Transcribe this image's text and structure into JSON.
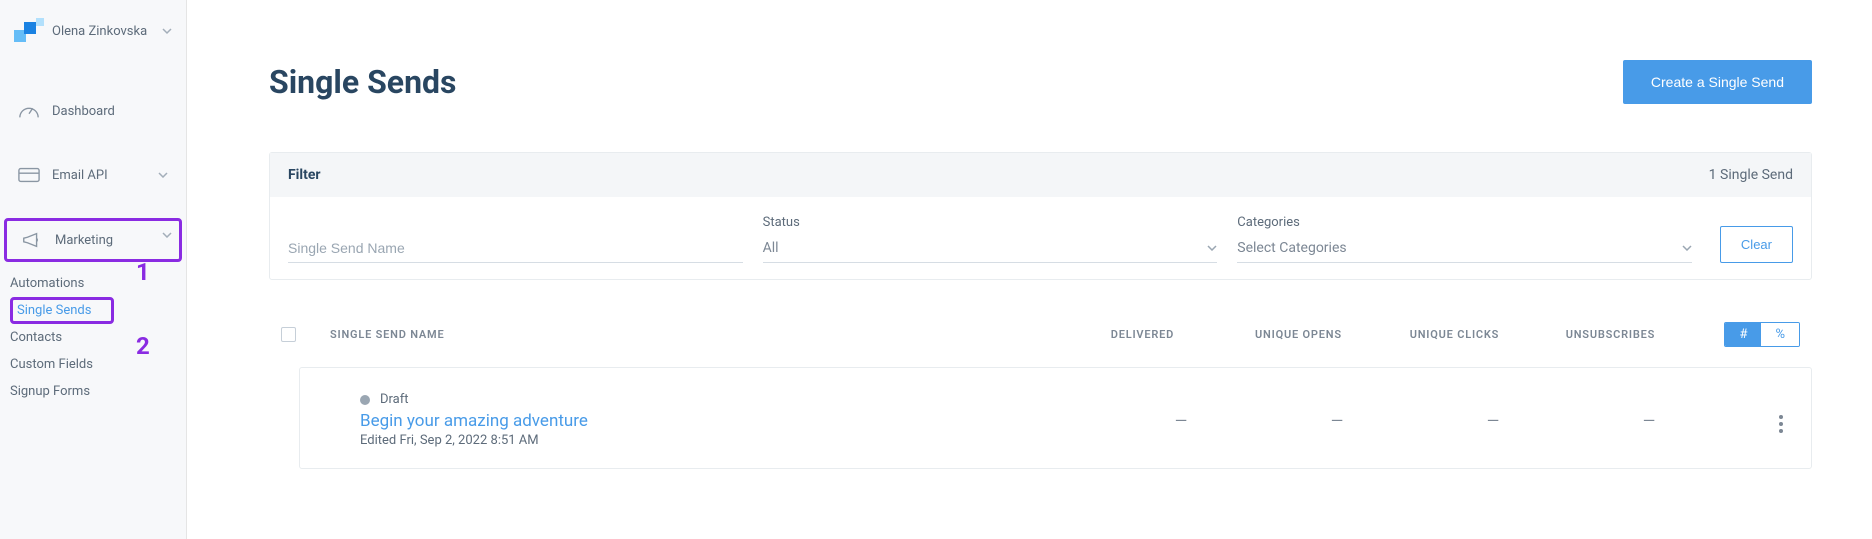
{
  "user": {
    "name": "Olena Zinkovska"
  },
  "sidebar": {
    "dashboard": "Dashboard",
    "emailApi": "Email API",
    "marketing": "Marketing",
    "sub": {
      "automations": "Automations",
      "singleSends": "Single Sends",
      "contacts": "Contacts",
      "customFields": "Custom Fields",
      "signupForms": "Signup Forms"
    }
  },
  "annotations": {
    "one": "1",
    "two": "2"
  },
  "page": {
    "title": "Single Sends",
    "createBtn": "Create a Single Send"
  },
  "filter": {
    "heading": "Filter",
    "count": "1 Single Send",
    "namePlaceholder": "Single Send Name",
    "statusLabel": "Status",
    "statusValue": "All",
    "categoriesLabel": "Categories",
    "categoriesPlaceholder": "Select Categories",
    "clear": "Clear"
  },
  "table": {
    "headers": {
      "name": "SINGLE SEND NAME",
      "delivered": "DELIVERED",
      "opens": "UNIQUE OPENS",
      "clicks": "UNIQUE CLICKS",
      "unsubs": "UNSUBSCRIBES"
    },
    "toggle": {
      "hash": "#",
      "pct": "%"
    },
    "rows": [
      {
        "status": "Draft",
        "title": "Begin your amazing adventure",
        "meta": "Edited Fri, Sep 2, 2022 8:51 AM",
        "delivered": "—",
        "opens": "—",
        "clicks": "—",
        "unsubs": "—"
      }
    ]
  }
}
